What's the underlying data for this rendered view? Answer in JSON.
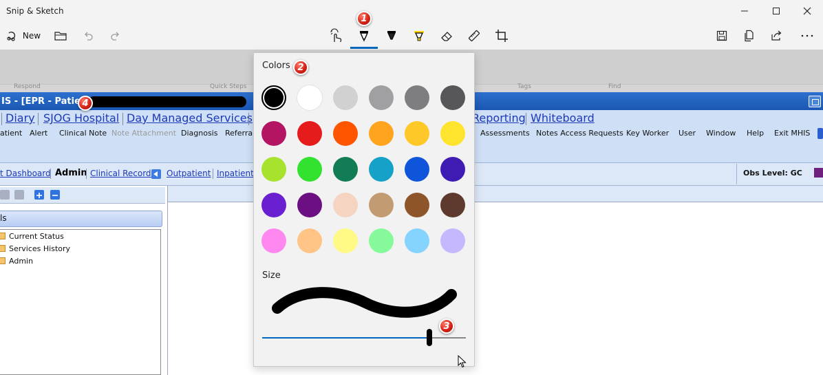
{
  "app": {
    "title": "Snip & Sketch"
  },
  "toolbar": {
    "new_label": "New",
    "icons": [
      "new-snip-icon",
      "open-folder-icon",
      "undo-icon",
      "redo-icon",
      "touch-writing-icon",
      "ballpoint-pen-icon",
      "pencil-icon",
      "highlighter-icon",
      "eraser-icon",
      "ruler-icon",
      "crop-icon",
      "save-icon",
      "copy-icon",
      "share-icon",
      "more-icon"
    ],
    "active_tool": "ballpoint-pen"
  },
  "flyout": {
    "colors_label": "Colors",
    "size_label": "Size",
    "selected_color": "#000000",
    "size_level": 0.82,
    "colors": [
      "#000000",
      "#ffffff",
      "#d1d1d1",
      "#a0a0a2",
      "#7e7e80",
      "#575759",
      "#b31564",
      "#e61b1b",
      "#ff5500",
      "#ffa41c",
      "#ffc829",
      "#ffe42e",
      "#a6e22e",
      "#33e22e",
      "#127d55",
      "#16a2c8",
      "#0e55dc",
      "#3e1cb3",
      "#6a20d1",
      "#6b0f83",
      "#f5d4c2",
      "#c29b72",
      "#8f552a",
      "#5d392e",
      "#ff88f0",
      "#ffc486",
      "#fffa85",
      "#86fa9a",
      "#85d4ff",
      "#c5b8ff"
    ]
  },
  "background": {
    "ghost_labels": [
      "Respond",
      "Quick Steps",
      "Tags",
      "Find"
    ],
    "epr_title": "IS - [EPR - Patient",
    "menu_links": [
      "Diary",
      "SJOG Hospital",
      "Day Managed Services",
      "Reporting",
      "Whiteboard"
    ],
    "menu_items": [
      "atient",
      "Alert",
      "Clinical Note",
      "Note Attachment",
      "Diagnosis",
      "Referral",
      "Assessments",
      "Notes Access Requests",
      "Key Worker",
      "User",
      "Window",
      "Help",
      "Exit MHIS"
    ],
    "nav": {
      "links": [
        "t Dashboard",
        "Clinical Records",
        "Outpatient",
        "Inpatient"
      ],
      "current": "Admin",
      "obs_level": "Obs Level: GC"
    },
    "left_panel": {
      "header": "ls",
      "tree": [
        "Current Status",
        "Services History",
        "Admin"
      ]
    }
  },
  "badges": [
    "1",
    "2",
    "3",
    "4"
  ]
}
